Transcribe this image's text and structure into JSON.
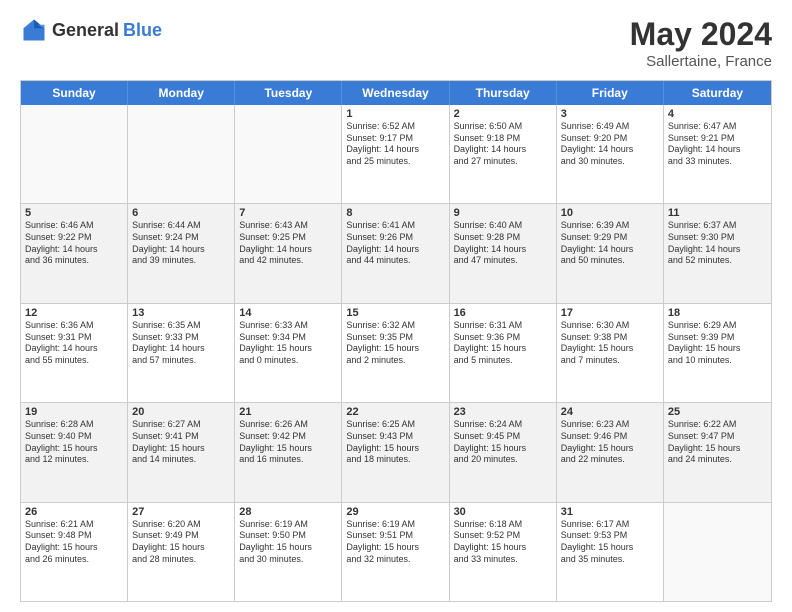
{
  "header": {
    "logo_general": "General",
    "logo_blue": "Blue",
    "month_year": "May 2024",
    "location": "Sallertaine, France"
  },
  "days_of_week": [
    "Sunday",
    "Monday",
    "Tuesday",
    "Wednesday",
    "Thursday",
    "Friday",
    "Saturday"
  ],
  "weeks": [
    {
      "alt": false,
      "cells": [
        {
          "day": "",
          "lines": []
        },
        {
          "day": "",
          "lines": []
        },
        {
          "day": "",
          "lines": []
        },
        {
          "day": "1",
          "lines": [
            "Sunrise: 6:52 AM",
            "Sunset: 9:17 PM",
            "Daylight: 14 hours",
            "and 25 minutes."
          ]
        },
        {
          "day": "2",
          "lines": [
            "Sunrise: 6:50 AM",
            "Sunset: 9:18 PM",
            "Daylight: 14 hours",
            "and 27 minutes."
          ]
        },
        {
          "day": "3",
          "lines": [
            "Sunrise: 6:49 AM",
            "Sunset: 9:20 PM",
            "Daylight: 14 hours",
            "and 30 minutes."
          ]
        },
        {
          "day": "4",
          "lines": [
            "Sunrise: 6:47 AM",
            "Sunset: 9:21 PM",
            "Daylight: 14 hours",
            "and 33 minutes."
          ]
        }
      ]
    },
    {
      "alt": true,
      "cells": [
        {
          "day": "5",
          "lines": [
            "Sunrise: 6:46 AM",
            "Sunset: 9:22 PM",
            "Daylight: 14 hours",
            "and 36 minutes."
          ]
        },
        {
          "day": "6",
          "lines": [
            "Sunrise: 6:44 AM",
            "Sunset: 9:24 PM",
            "Daylight: 14 hours",
            "and 39 minutes."
          ]
        },
        {
          "day": "7",
          "lines": [
            "Sunrise: 6:43 AM",
            "Sunset: 9:25 PM",
            "Daylight: 14 hours",
            "and 42 minutes."
          ]
        },
        {
          "day": "8",
          "lines": [
            "Sunrise: 6:41 AM",
            "Sunset: 9:26 PM",
            "Daylight: 14 hours",
            "and 44 minutes."
          ]
        },
        {
          "day": "9",
          "lines": [
            "Sunrise: 6:40 AM",
            "Sunset: 9:28 PM",
            "Daylight: 14 hours",
            "and 47 minutes."
          ]
        },
        {
          "day": "10",
          "lines": [
            "Sunrise: 6:39 AM",
            "Sunset: 9:29 PM",
            "Daylight: 14 hours",
            "and 50 minutes."
          ]
        },
        {
          "day": "11",
          "lines": [
            "Sunrise: 6:37 AM",
            "Sunset: 9:30 PM",
            "Daylight: 14 hours",
            "and 52 minutes."
          ]
        }
      ]
    },
    {
      "alt": false,
      "cells": [
        {
          "day": "12",
          "lines": [
            "Sunrise: 6:36 AM",
            "Sunset: 9:31 PM",
            "Daylight: 14 hours",
            "and 55 minutes."
          ]
        },
        {
          "day": "13",
          "lines": [
            "Sunrise: 6:35 AM",
            "Sunset: 9:33 PM",
            "Daylight: 14 hours",
            "and 57 minutes."
          ]
        },
        {
          "day": "14",
          "lines": [
            "Sunrise: 6:33 AM",
            "Sunset: 9:34 PM",
            "Daylight: 15 hours",
            "and 0 minutes."
          ]
        },
        {
          "day": "15",
          "lines": [
            "Sunrise: 6:32 AM",
            "Sunset: 9:35 PM",
            "Daylight: 15 hours",
            "and 2 minutes."
          ]
        },
        {
          "day": "16",
          "lines": [
            "Sunrise: 6:31 AM",
            "Sunset: 9:36 PM",
            "Daylight: 15 hours",
            "and 5 minutes."
          ]
        },
        {
          "day": "17",
          "lines": [
            "Sunrise: 6:30 AM",
            "Sunset: 9:38 PM",
            "Daylight: 15 hours",
            "and 7 minutes."
          ]
        },
        {
          "day": "18",
          "lines": [
            "Sunrise: 6:29 AM",
            "Sunset: 9:39 PM",
            "Daylight: 15 hours",
            "and 10 minutes."
          ]
        }
      ]
    },
    {
      "alt": true,
      "cells": [
        {
          "day": "19",
          "lines": [
            "Sunrise: 6:28 AM",
            "Sunset: 9:40 PM",
            "Daylight: 15 hours",
            "and 12 minutes."
          ]
        },
        {
          "day": "20",
          "lines": [
            "Sunrise: 6:27 AM",
            "Sunset: 9:41 PM",
            "Daylight: 15 hours",
            "and 14 minutes."
          ]
        },
        {
          "day": "21",
          "lines": [
            "Sunrise: 6:26 AM",
            "Sunset: 9:42 PM",
            "Daylight: 15 hours",
            "and 16 minutes."
          ]
        },
        {
          "day": "22",
          "lines": [
            "Sunrise: 6:25 AM",
            "Sunset: 9:43 PM",
            "Daylight: 15 hours",
            "and 18 minutes."
          ]
        },
        {
          "day": "23",
          "lines": [
            "Sunrise: 6:24 AM",
            "Sunset: 9:45 PM",
            "Daylight: 15 hours",
            "and 20 minutes."
          ]
        },
        {
          "day": "24",
          "lines": [
            "Sunrise: 6:23 AM",
            "Sunset: 9:46 PM",
            "Daylight: 15 hours",
            "and 22 minutes."
          ]
        },
        {
          "day": "25",
          "lines": [
            "Sunrise: 6:22 AM",
            "Sunset: 9:47 PM",
            "Daylight: 15 hours",
            "and 24 minutes."
          ]
        }
      ]
    },
    {
      "alt": false,
      "cells": [
        {
          "day": "26",
          "lines": [
            "Sunrise: 6:21 AM",
            "Sunset: 9:48 PM",
            "Daylight: 15 hours",
            "and 26 minutes."
          ]
        },
        {
          "day": "27",
          "lines": [
            "Sunrise: 6:20 AM",
            "Sunset: 9:49 PM",
            "Daylight: 15 hours",
            "and 28 minutes."
          ]
        },
        {
          "day": "28",
          "lines": [
            "Sunrise: 6:19 AM",
            "Sunset: 9:50 PM",
            "Daylight: 15 hours",
            "and 30 minutes."
          ]
        },
        {
          "day": "29",
          "lines": [
            "Sunrise: 6:19 AM",
            "Sunset: 9:51 PM",
            "Daylight: 15 hours",
            "and 32 minutes."
          ]
        },
        {
          "day": "30",
          "lines": [
            "Sunrise: 6:18 AM",
            "Sunset: 9:52 PM",
            "Daylight: 15 hours",
            "and 33 minutes."
          ]
        },
        {
          "day": "31",
          "lines": [
            "Sunrise: 6:17 AM",
            "Sunset: 9:53 PM",
            "Daylight: 15 hours",
            "and 35 minutes."
          ]
        },
        {
          "day": "",
          "lines": []
        }
      ]
    }
  ]
}
